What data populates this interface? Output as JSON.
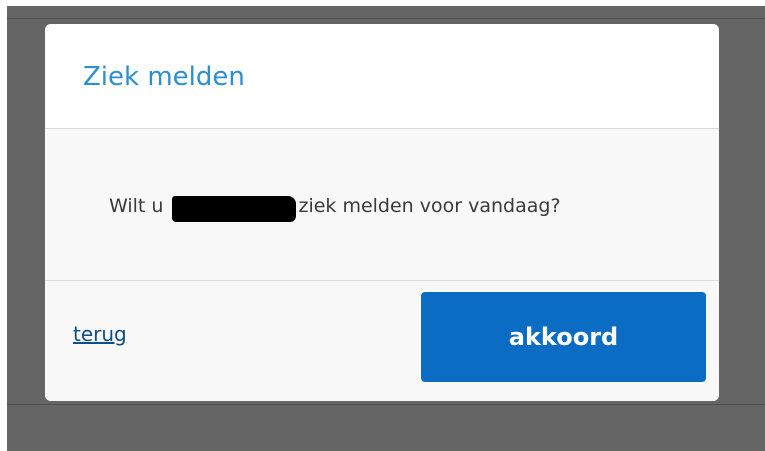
{
  "dialog": {
    "title": "Ziek melden",
    "message_before": "Wilt u",
    "message_after": "ziek melden voor vandaag?",
    "back_label": "terug",
    "agree_label": "akkoord"
  },
  "colors": {
    "title": "#2e8fd0",
    "button": "#0b6cc4",
    "link": "#0f4f86",
    "backdrop": "#656565"
  }
}
